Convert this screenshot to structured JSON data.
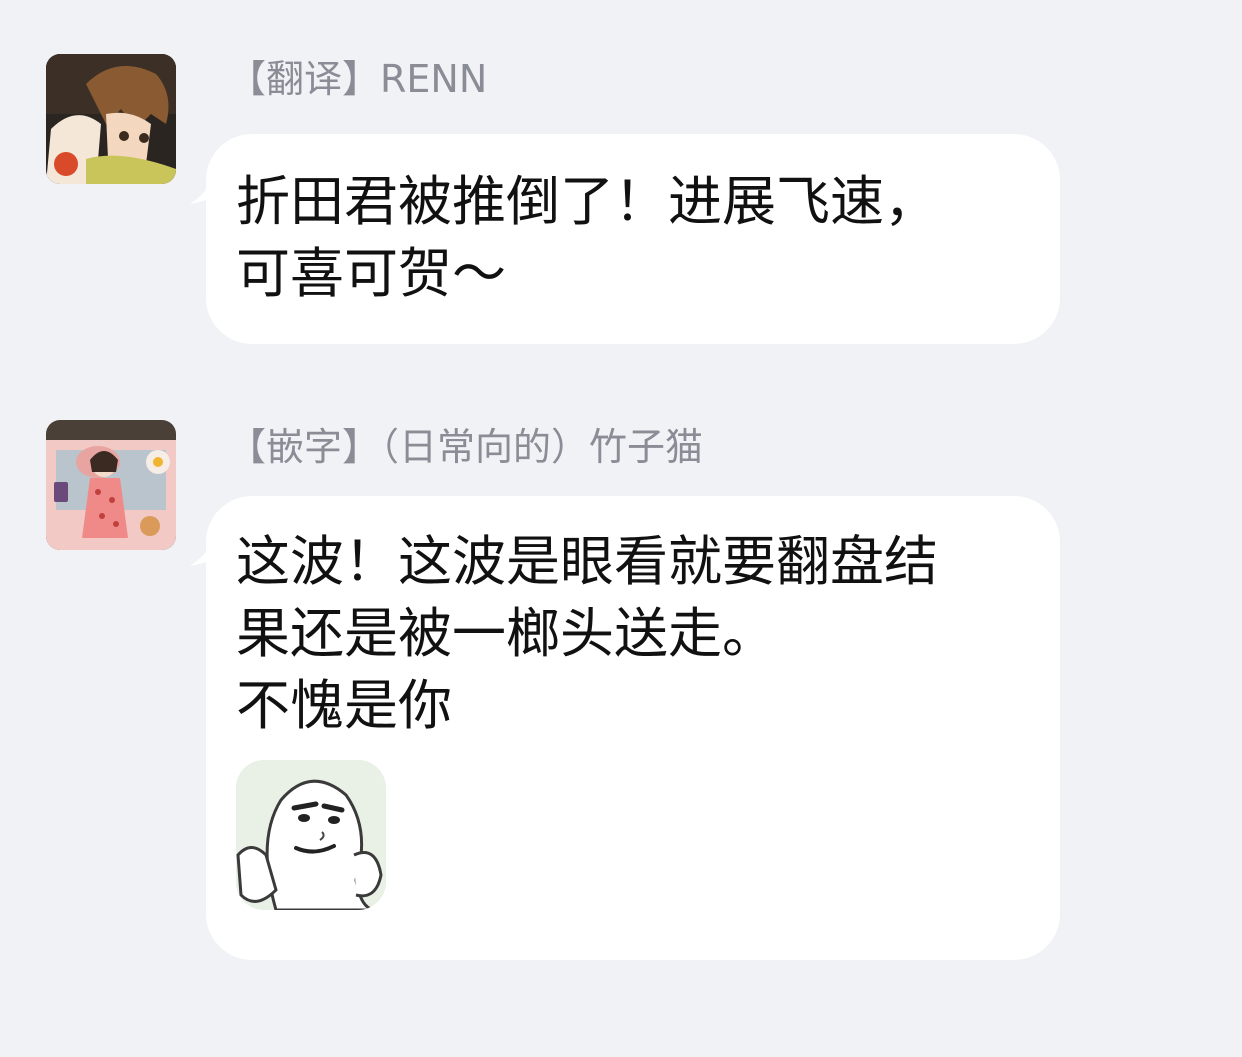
{
  "messages": [
    {
      "sender": "【翻译】RENN",
      "avatar_icon": "anime-boy-avatar",
      "text": "折田君被推倒了！进展飞速，\n可喜可贺～"
    },
    {
      "sender": "【嵌字】（日常向的）竹子猫",
      "avatar_icon": "girl-on-bed-avatar",
      "text": "这波！这波是眼看就要翻盘结\n果还是被一榔头送走。\n不愧是你",
      "sticker_icon": "smug-face-sticker"
    }
  ],
  "colors": {
    "background": "#f1f2f6",
    "bubble": "#ffffff",
    "sender_text": "#8a8d96",
    "message_text": "#111111"
  }
}
